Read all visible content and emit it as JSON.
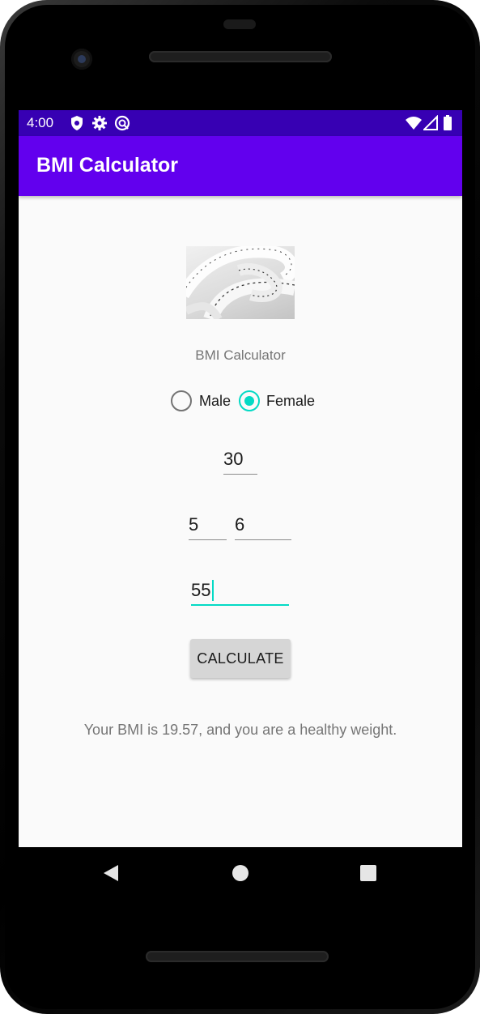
{
  "status_bar": {
    "time": "4:00",
    "left_icons": [
      "shield-icon",
      "gear-icon",
      "sync-icon"
    ],
    "right_icons": [
      "wifi-icon",
      "signal-icon",
      "battery-icon"
    ],
    "color": "#3700b3"
  },
  "app_bar": {
    "title": "BMI Calculator",
    "color": "#6200ee"
  },
  "main": {
    "image": "measuring-tape-image",
    "subtitle": "BMI Calculator",
    "gender": {
      "options": [
        {
          "label": "Male",
          "selected": false
        },
        {
          "label": "Female",
          "selected": true
        }
      ]
    },
    "age_value": "30",
    "height_feet_value": "5",
    "height_inches_value": "6",
    "weight_value": "55",
    "calculate_label": "CALCULATE",
    "result_text": "Your BMI is 19.57, and you are a healthy weight."
  },
  "colors": {
    "accent": "#03dac5",
    "primary": "#6200ee",
    "primary_dark": "#3700b3"
  },
  "nav_bar": {
    "icons": [
      "back-icon",
      "home-icon",
      "recents-icon"
    ]
  }
}
